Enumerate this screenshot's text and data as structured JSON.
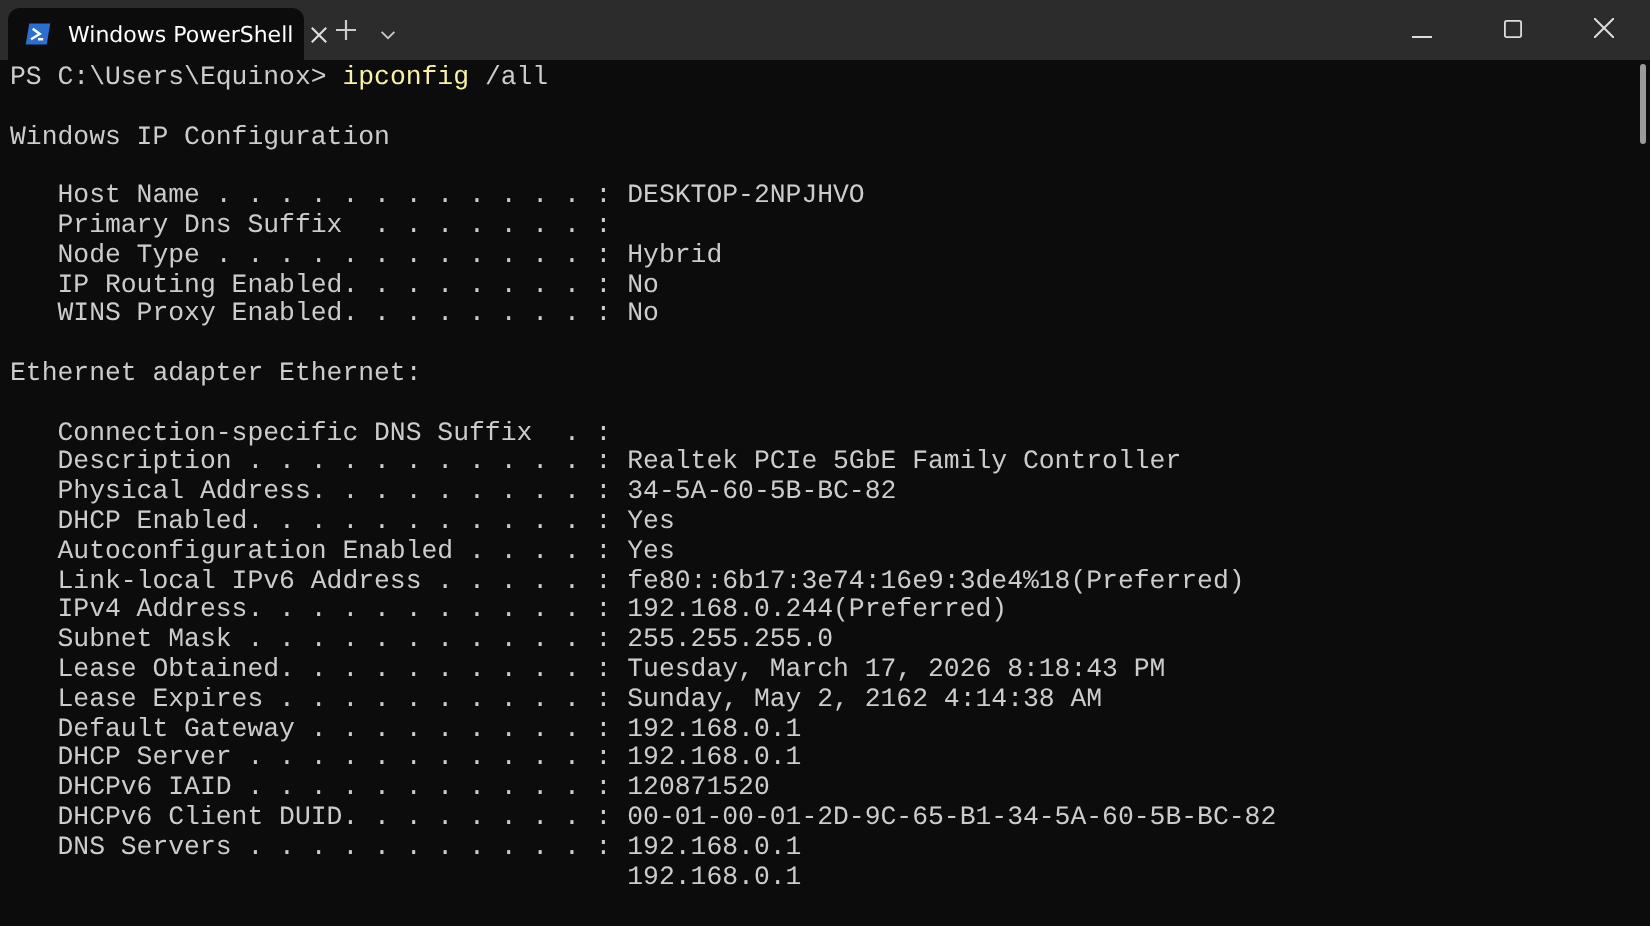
{
  "tabs": [
    {
      "title": "Windows PowerShell",
      "selected": true
    }
  ],
  "lines": [
    {
      "kind": "prompt",
      "prompt": "PS C:\\Users\\Equinox>",
      "command": "ipconfig",
      "args": "/all"
    },
    {
      "kind": "blank"
    },
    {
      "kind": "text",
      "text": "Windows IP Configuration"
    },
    {
      "kind": "blank"
    },
    {
      "kind": "text",
      "text": "   Host Name . . . . . . . . . . . . : DESKTOP-2NPJHVO"
    },
    {
      "kind": "text",
      "text": "   Primary Dns Suffix  . . . . . . . :"
    },
    {
      "kind": "text",
      "text": "   Node Type . . . . . . . . . . . . : Hybrid"
    },
    {
      "kind": "text",
      "text": "   IP Routing Enabled. . . . . . . . : No"
    },
    {
      "kind": "text",
      "text": "   WINS Proxy Enabled. . . . . . . . : No"
    },
    {
      "kind": "blank"
    },
    {
      "kind": "text",
      "text": "Ethernet adapter Ethernet:"
    },
    {
      "kind": "blank"
    },
    {
      "kind": "text",
      "text": "   Connection-specific DNS Suffix  . :"
    },
    {
      "kind": "text",
      "text": "   Description . . . . . . . . . . . : Realtek PCIe 5GbE Family Controller"
    },
    {
      "kind": "text",
      "text": "   Physical Address. . . . . . . . . : 34-5A-60-5B-BC-82"
    },
    {
      "kind": "text",
      "text": "   DHCP Enabled. . . . . . . . . . . : Yes"
    },
    {
      "kind": "text",
      "text": "   Autoconfiguration Enabled . . . . : Yes"
    },
    {
      "kind": "text",
      "text": "   Link-local IPv6 Address . . . . . : fe80::6b17:3e74:16e9:3de4%18(Preferred)"
    },
    {
      "kind": "text",
      "text": "   IPv4 Address. . . . . . . . . . . : 192.168.0.244(Preferred)"
    },
    {
      "kind": "text",
      "text": "   Subnet Mask . . . . . . . . . . . : 255.255.255.0"
    },
    {
      "kind": "text",
      "text": "   Lease Obtained. . . . . . . . . . : Tuesday, March 17, 2026 8:18:43 PM"
    },
    {
      "kind": "text",
      "text": "   Lease Expires . . . . . . . . . . : Sunday, May 2, 2162 4:14:38 AM"
    },
    {
      "kind": "text",
      "text": "   Default Gateway . . . . . . . . . : 192.168.0.1"
    },
    {
      "kind": "text",
      "text": "   DHCP Server . . . . . . . . . . . : 192.168.0.1"
    },
    {
      "kind": "text",
      "text": "   DHCPv6 IAID . . . . . . . . . . . : 120871520"
    },
    {
      "kind": "text",
      "text": "   DHCPv6 Client DUID. . . . . . . . : 00-01-00-01-2D-9C-65-B1-34-5A-60-5B-BC-82"
    },
    {
      "kind": "text",
      "text": "   DNS Servers . . . . . . . . . . . : 192.168.0.1"
    },
    {
      "kind": "text",
      "text": "                                       192.168.0.1"
    }
  ]
}
